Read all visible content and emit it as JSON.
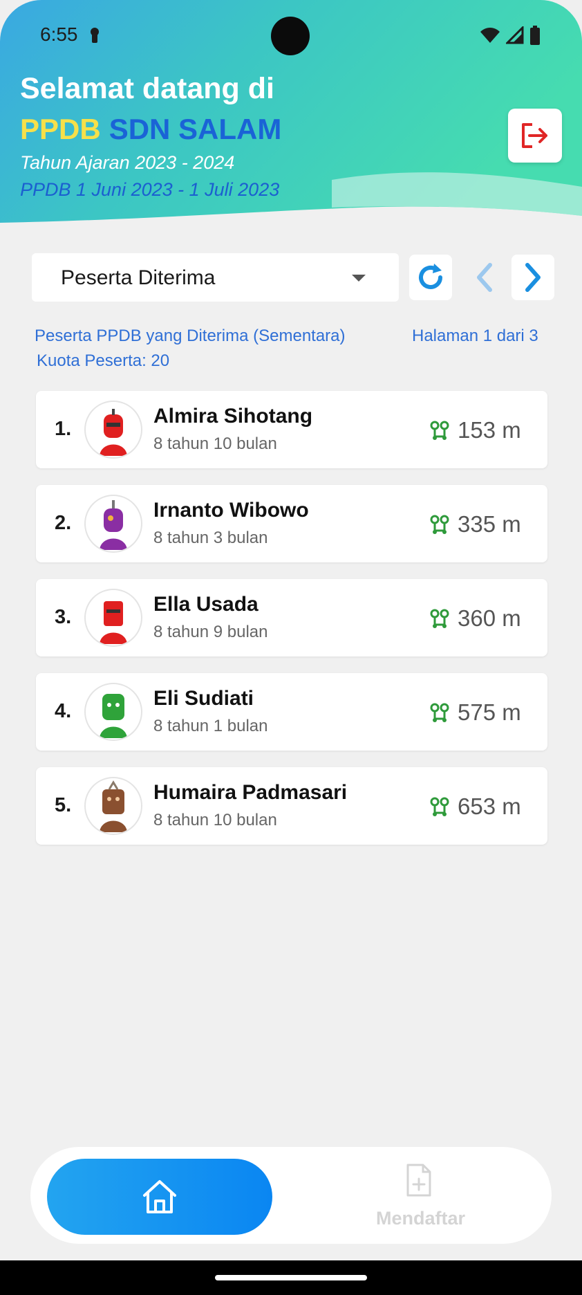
{
  "status_bar": {
    "time": "6:55"
  },
  "header": {
    "welcome": "Selamat datang di",
    "brand_ppdb": "PPDB",
    "brand_school": "SDN SALAM",
    "academic_year": "Tahun Ajaran 2023 - 2024",
    "period": "PPDB 1 Juni 2023 - 1 Juli 2023",
    "logout_icon": "logout-icon"
  },
  "filter": {
    "selected": "Peserta Diterima",
    "refresh_icon": "refresh-icon",
    "prev_icon": "chevron-left-icon",
    "next_icon": "chevron-right-icon"
  },
  "list_info": {
    "title": "Peserta PPDB yang Diterima (Sementara)",
    "page": "Halaman 1 dari 3",
    "quota": "Kuota Peserta: 20"
  },
  "participants": [
    {
      "rank": "1.",
      "name": "Almira Sihotang",
      "age": "8 tahun 10 bulan",
      "distance": "153 m",
      "avatar_color": "#e02020"
    },
    {
      "rank": "2.",
      "name": "Irnanto Wibowo",
      "age": "8 tahun 3 bulan",
      "distance": "335 m",
      "avatar_color": "#8a2ea3"
    },
    {
      "rank": "3.",
      "name": "Ella Usada",
      "age": "8 tahun 9 bulan",
      "distance": "360 m",
      "avatar_color": "#e02020"
    },
    {
      "rank": "4.",
      "name": "Eli Sudiati",
      "age": "8 tahun 1 bulan",
      "distance": "575 m",
      "avatar_color": "#2fa33a"
    },
    {
      "rank": "5.",
      "name": "Humaira Padmasari",
      "age": "8 tahun 10 bulan",
      "distance": "653 m",
      "avatar_color": "#8a5030"
    }
  ],
  "bottom_nav": {
    "home_icon": "home-icon",
    "register_label": "Mendaftar",
    "register_icon": "file-add-icon"
  },
  "colors": {
    "accent": "#1a63d6",
    "brand_yellow": "#f6e04a",
    "header_teal": "#3ed4b4",
    "distance_green": "#2e9a3a"
  }
}
